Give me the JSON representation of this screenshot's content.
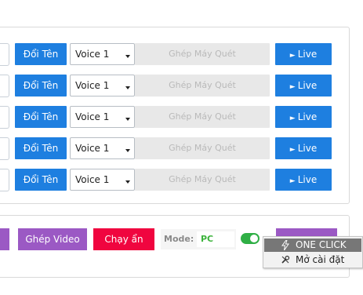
{
  "rows": [
    {
      "rename_label": "Đổi Tên",
      "voice": "Voice 1",
      "merge_label": "Ghép Máy Quét",
      "live_label": "Live"
    },
    {
      "rename_label": "Đổi Tên",
      "voice": "Voice 1",
      "merge_label": "Ghép Máy Quét",
      "live_label": "Live"
    },
    {
      "rename_label": "Đổi Tên",
      "voice": "Voice 1",
      "merge_label": "Ghép Máy Quét",
      "live_label": "Live"
    },
    {
      "rename_label": "Đổi Tên",
      "voice": "Voice 1",
      "merge_label": "Ghép Máy Quét",
      "live_label": "Live"
    },
    {
      "rename_label": "Đổi Tên",
      "voice": "Voice 1",
      "merge_label": "Ghép Máy Quét",
      "live_label": "Live"
    }
  ],
  "bottom": {
    "merge_video_label": "Ghép Video",
    "run_hidden_label": "Chạy ẩn",
    "mode_label": "Mode:",
    "mode_value": "PC",
    "toggle_on": true
  },
  "context_menu": {
    "items": [
      {
        "label": "ONE CLICK",
        "icon": "lightning-icon",
        "highlighted": true
      },
      {
        "label": "Mở cài đặt",
        "icon": "tools-icon",
        "highlighted": false
      }
    ]
  },
  "colors": {
    "primary_blue": "#1e7fe0",
    "purple": "#9b59c4",
    "red": "#f0053f",
    "disabled_gray": "#e8e8e8",
    "toggle_green": "#2faf45",
    "mode_green": "#3cb33c"
  }
}
